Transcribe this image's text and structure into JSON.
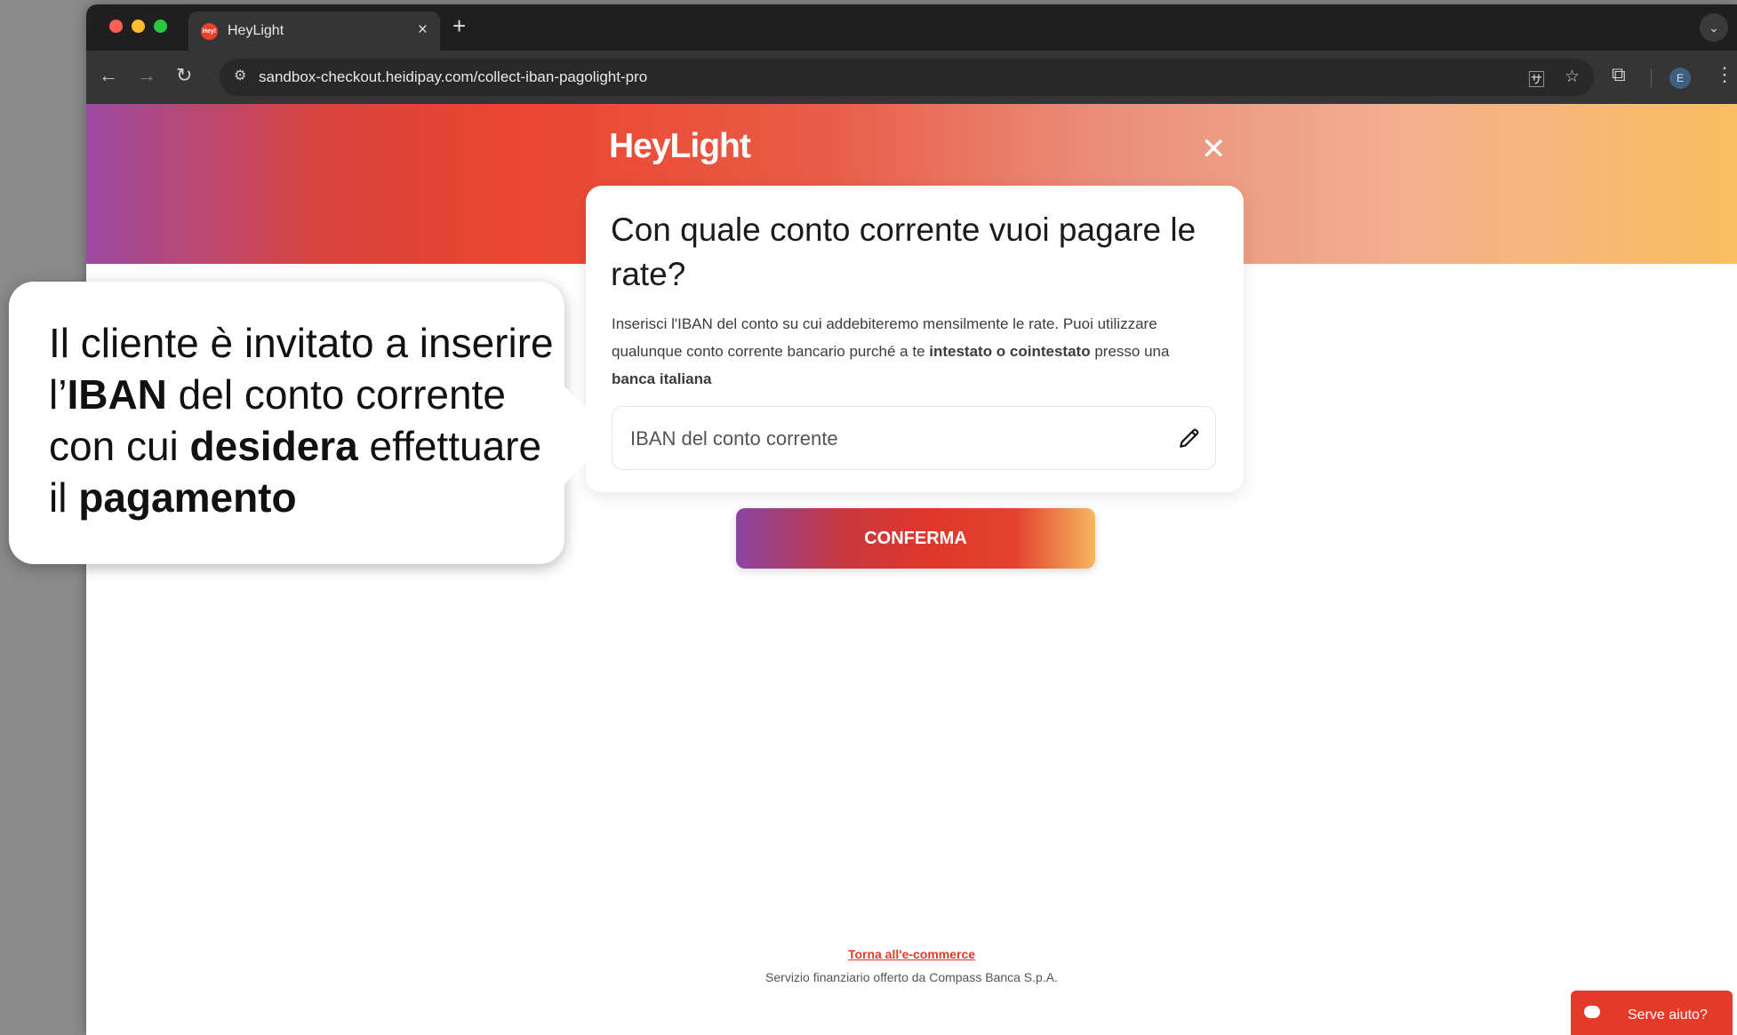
{
  "browser": {
    "tab": {
      "favicon_text": "Hey!",
      "title": "HeyLight",
      "close": "×"
    },
    "new_tab": "+",
    "tab_menu": "⌄",
    "nav": {
      "back": "←",
      "forward": "→",
      "reload": "↻"
    },
    "site_info_icon": "⚙",
    "url": "sandbox-checkout.heidipay.com/collect-iban-pagolight-pro",
    "translate_icon": "🈂",
    "star_icon": "☆",
    "extensions_icon": "⧉",
    "profile_initial": "E",
    "menu_icon": "⋮"
  },
  "page": {
    "logo": "HeyLight",
    "close": "✕",
    "card": {
      "title": "Con quale conto corrente vuoi pagare le rate?",
      "desc_part1": "Inserisci l'IBAN del conto su cui addebiteremo mensilmente le rate. Puoi utilizzare qualunque conto corrente bancario purché a te ",
      "desc_bold1": "intestato o cointestato",
      "desc_part2": " presso una ",
      "desc_bold2": "banca italiana",
      "iban_placeholder": "IBAN del conto corrente"
    },
    "confirm_button": "CONFERMA",
    "back_link": "Torna all'e-commerce",
    "footer_note": "Servizio finanziario offerto da Compass Banca S.p.A.",
    "help_button": "Serve aiuto?"
  },
  "callout": {
    "line1": "Il cliente è invitato a inserire l’",
    "bold1": "IBAN",
    "line2": " del conto corrente con cui ",
    "bold2": "desidera",
    "line3": " effettuare il ",
    "bold3": "pagamento"
  },
  "colors": {
    "brand_red": "#e53a2a",
    "dark_ui": "#1f1f1f"
  }
}
